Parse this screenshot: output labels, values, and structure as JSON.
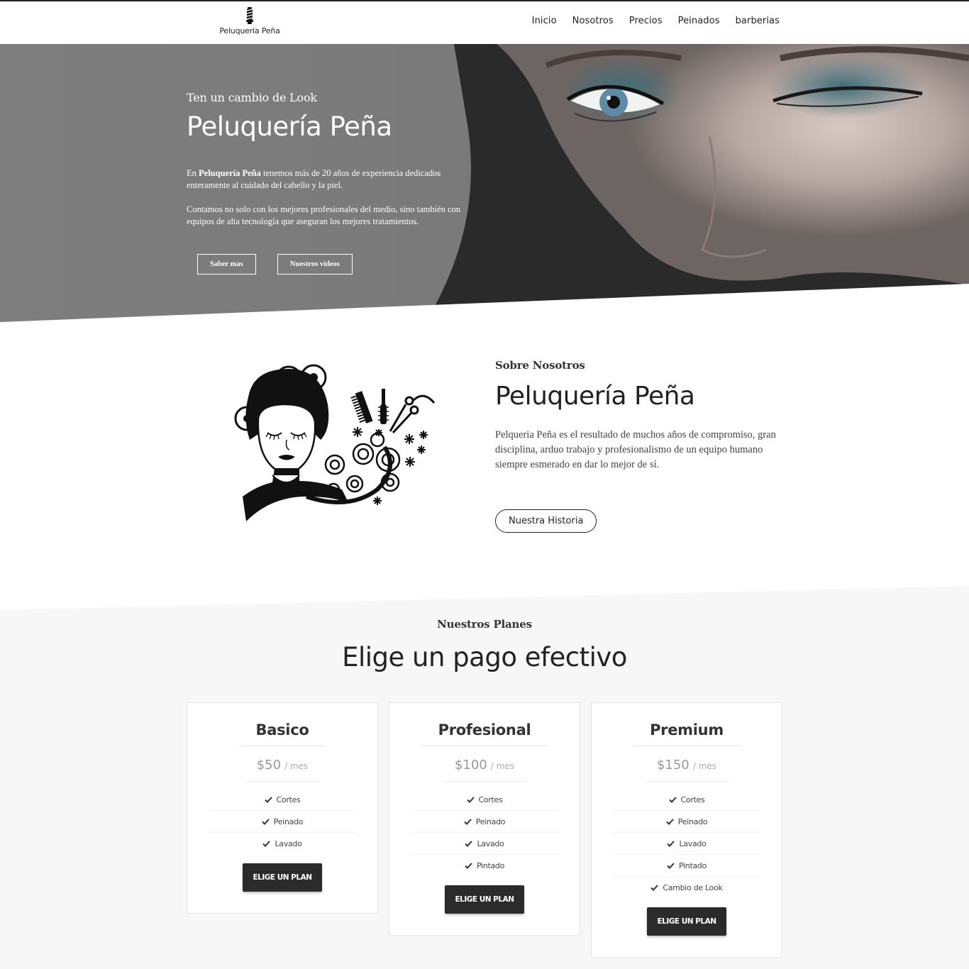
{
  "brand": {
    "name": "Peluqueria Peña"
  },
  "nav": {
    "items": [
      "Inicio",
      "Nosotros",
      "Precios",
      "Peinados",
      "barberias"
    ]
  },
  "hero": {
    "kicker": "Ten un cambio de Look",
    "title": "Peluquería Peña",
    "p1_pre": "En ",
    "p1_bold": "Peluquería Peña",
    "p1_post": " tenemos más de 20 años de experiencia dedicados enteramente al cuidado del cabello y la piel.",
    "p2": "Contamos no solo con los mejores profesionales del medio, sino también con equipos de alta tecnología que aseguran los mejores tratamientos.",
    "btn_more": "Saber mas",
    "btn_videos": "Nuestros videos"
  },
  "about": {
    "kicker": "Sobre Nosotros",
    "title": "Peluquería Peña",
    "text": "Pelqueria Peña es el resultado de muchos años de compromiso, gran disciplina, arduo trabajo y profesionalismo de un equipo humano siempre esmerado en dar lo mejor de sí.",
    "btn": "Nuestra Historia"
  },
  "plans": {
    "kicker": "Nuestros Planes",
    "title": "Elige un pago efectivo",
    "items": [
      {
        "name": "Basico",
        "price": "$50",
        "per": "/ mes",
        "features": [
          "Cortes",
          "Peinado",
          "Lavado"
        ],
        "btn": "ELIGE UN PLAN"
      },
      {
        "name": "Profesional",
        "price": "$100",
        "per": "/ mes",
        "features": [
          "Cortes",
          "Peinado",
          "Lavado",
          "Pintado"
        ],
        "btn": "ELIGE UN PLAN"
      },
      {
        "name": "Premium",
        "price": "$150",
        "per": "/ mes",
        "features": [
          "Cortes",
          "Peinado",
          "Lavado",
          "Pintado",
          "Cambio de Look"
        ],
        "btn": "ELIGE UN PLAN"
      }
    ]
  },
  "colors": {
    "hero_gray": "#7d7d7d",
    "dark": "#2b2b2b",
    "plans_bg": "#f7f7f7"
  }
}
